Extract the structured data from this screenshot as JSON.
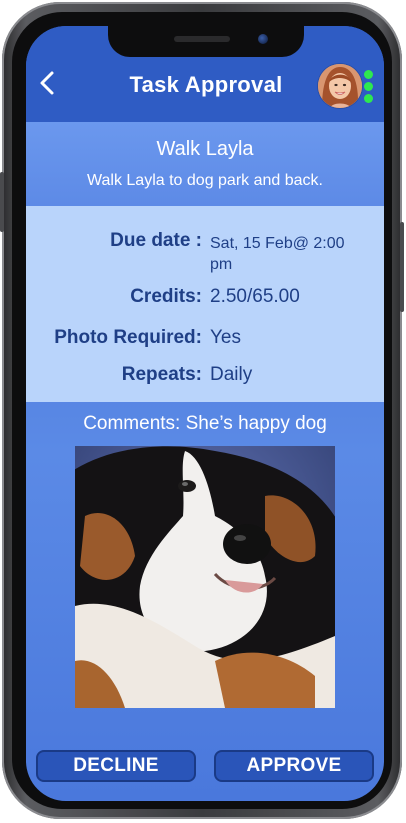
{
  "header": {
    "title": "Task Approval",
    "back_icon": "chevron-left-icon",
    "menu_icon": "vertical-dots-icon"
  },
  "task": {
    "title": "Walk Layla",
    "description": "Walk Layla to dog park and back."
  },
  "details": [
    {
      "label": "Due date :",
      "value": "Sat, 15 Feb@ 2:00 pm"
    },
    {
      "label": "Credits:",
      "value": "2.50/65.00"
    },
    {
      "label": "Photo Required:",
      "value": "Yes"
    },
    {
      "label": "Repeats:",
      "value": "Daily"
    }
  ],
  "comments": "Comments: She’s happy dog",
  "actions": {
    "decline_label": "DECLINE",
    "approve_label": "APPROVE"
  },
  "colors": {
    "header_bg": "#2f5cc4",
    "details_bg": "#b9d4fb",
    "label_text": "#1f3f86",
    "menu_dots": "#2ee84f",
    "button_bg": "#2a55b9"
  }
}
